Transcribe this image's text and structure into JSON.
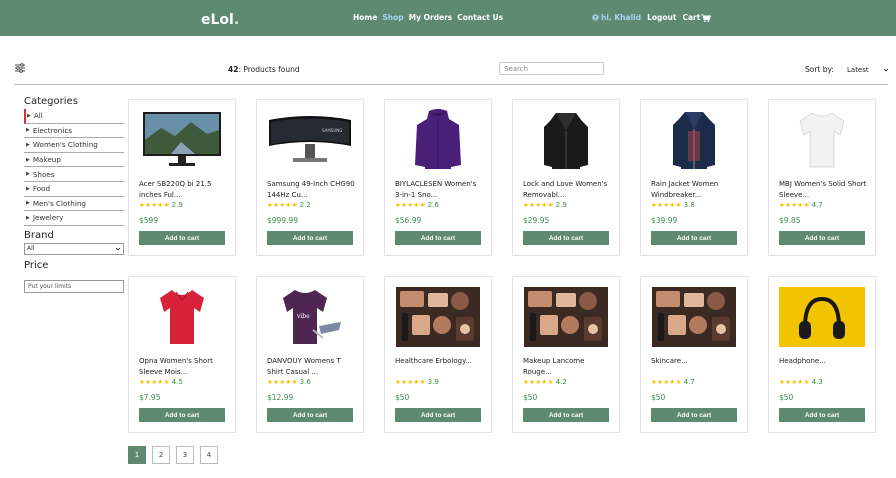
{
  "nav": {
    "brand": "eLol",
    "brand_dot": ".",
    "links": [
      "Home",
      "Shop",
      "My Orders",
      "Contact Us"
    ],
    "active_link": "Shop",
    "user_greeting": "hi, Khalid",
    "logout": "Logout",
    "cart": "Cart"
  },
  "toolbar": {
    "count": "42",
    "count_suffix": ": Products found",
    "search_placeholder": "Search",
    "sort_label": "Sort by:",
    "sort_value": "Latest"
  },
  "sidebar": {
    "categories_title": "Categories",
    "categories": [
      "All",
      "Electronics",
      "Women's Clothing",
      "Makeup",
      "Shoes",
      "Food",
      "Men's Clothing",
      "Jewelery"
    ],
    "active_category": "All",
    "brand_title": "Brand",
    "brand_value": "All",
    "price_title": "Price",
    "price_placeholder": "Put your limits"
  },
  "products": [
    {
      "title": "Acer SB220Q bi 21.5 inches Ful...",
      "rating": "2.9",
      "price": "$599",
      "icon": "monitor-image"
    },
    {
      "title": "Samsung 49-Inch CHG90 144Hz Cu...",
      "rating": "2.2",
      "price": "$999.99",
      "icon": "curved-monitor-image"
    },
    {
      "title": "BIYLACLESEN Women's 3-in-1 Sno...",
      "rating": "2.6",
      "price": "$56.99",
      "icon": "purple-jacket-image"
    },
    {
      "title": "Lock and Love Women's Removabl...",
      "rating": "2.9",
      "price": "$29.95",
      "icon": "leather-jacket-image"
    },
    {
      "title": "Rain Jacket Women Windbreaker...",
      "rating": "3.8",
      "price": "$39.99",
      "icon": "rain-jacket-image"
    },
    {
      "title": "MBJ Women's Solid Short Sleeve...",
      "rating": "4.7",
      "price": "$9.85",
      "icon": "white-tshirt-image"
    },
    {
      "title": "Opna Women's Short Sleeve Mois...",
      "rating": "4.5",
      "price": "$7.95",
      "icon": "red-tshirt-image"
    },
    {
      "title": "DANVOUY Womens T Shirt Casual ...",
      "rating": "3.6",
      "price": "$12.99",
      "icon": "purple-tshirt-image"
    },
    {
      "title": "Healthcare Erbology...",
      "rating": "3.9",
      "price": "$50",
      "icon": "makeup-image"
    },
    {
      "title": "Makeup Lancome Rouge...",
      "rating": "4.2",
      "price": "$50",
      "icon": "makeup-image"
    },
    {
      "title": "Skincare...",
      "rating": "4.7",
      "price": "$50",
      "icon": "makeup-image"
    },
    {
      "title": "Headphone...",
      "rating": "4.3",
      "price": "$50",
      "icon": "headphone-image"
    }
  ],
  "add_to_cart": "Add to cart",
  "stars": "★★★★★",
  "pagination": [
    "1",
    "2",
    "3",
    "4"
  ],
  "active_page": "1",
  "colors": {
    "primary": "#5e8a71",
    "price": "#3d8c4f",
    "star": "#f2c200",
    "active_link": "#a8d4f3"
  }
}
